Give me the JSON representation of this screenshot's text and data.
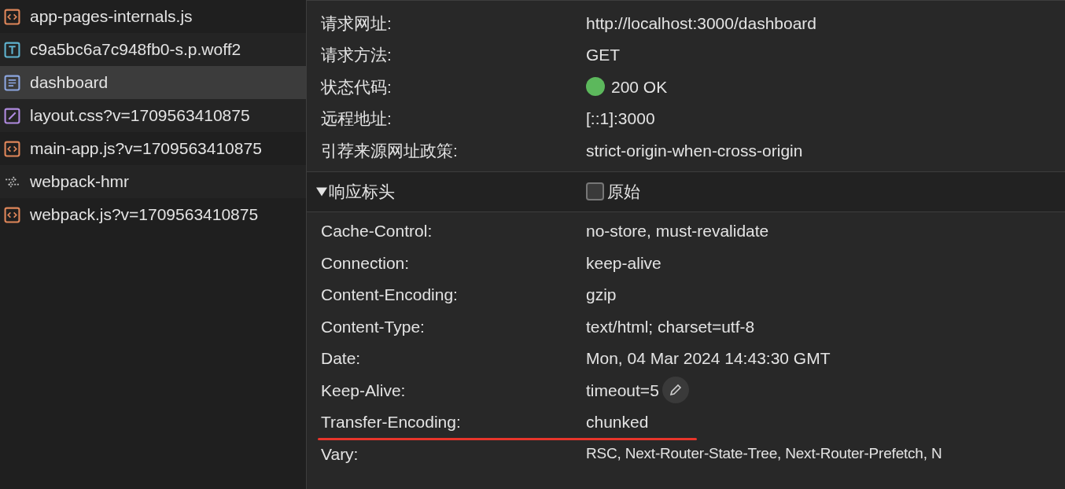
{
  "files": [
    {
      "name": "app-pages-internals.js",
      "kind": "script",
      "selected": false
    },
    {
      "name": "c9a5bc6a7c948fb0-s.p.woff2",
      "kind": "font",
      "selected": false
    },
    {
      "name": "dashboard",
      "kind": "document",
      "selected": true
    },
    {
      "name": "layout.css?v=1709563410875",
      "kind": "stylesheet",
      "selected": false
    },
    {
      "name": "main-app.js?v=1709563410875",
      "kind": "script",
      "selected": false
    },
    {
      "name": "webpack-hmr",
      "kind": "websocket",
      "selected": false
    },
    {
      "name": "webpack.js?v=1709563410875",
      "kind": "script",
      "selected": false
    }
  ],
  "general": [
    {
      "label": "请求网址:",
      "value": "http://localhost:3000/dashboard"
    },
    {
      "label": "请求方法:",
      "value": "GET"
    },
    {
      "label": "状态代码:",
      "value": "200 OK",
      "color": "#5cb85c"
    },
    {
      "label": "远程地址:",
      "value": "[::1]:3000"
    },
    {
      "label": "引荐来源网址政策:",
      "value": "strict-origin-when-cross-origin"
    }
  ],
  "response_headers": {
    "title": "响应标头",
    "expanded": true,
    "raw_label": "原始",
    "raw_checked": false,
    "rows": [
      {
        "name": "Cache-Control:",
        "value": "no-store, must-revalidate",
        "editable": false,
        "underlined": false
      },
      {
        "name": "Connection:",
        "value": "keep-alive",
        "editable": false,
        "underlined": false
      },
      {
        "name": "Content-Encoding:",
        "value": "gzip",
        "editable": false,
        "underlined": false
      },
      {
        "name": "Content-Type:",
        "value": "text/html; charset=utf-8",
        "editable": false,
        "underlined": false
      },
      {
        "name": "Date:",
        "value": "Mon, 04 Mar 2024 14:43:30 GMT",
        "editable": false,
        "underlined": false
      },
      {
        "name": "Keep-Alive:",
        "value": "timeout=5",
        "editable": true,
        "underlined": false
      },
      {
        "name": "Transfer-Encoding:",
        "value": "chunked",
        "editable": false,
        "underlined": true
      },
      {
        "name": "Vary:",
        "value": "RSC, Next-Router-State-Tree, Next-Router-Prefetch, N",
        "editable": false,
        "underlined": false
      }
    ]
  }
}
